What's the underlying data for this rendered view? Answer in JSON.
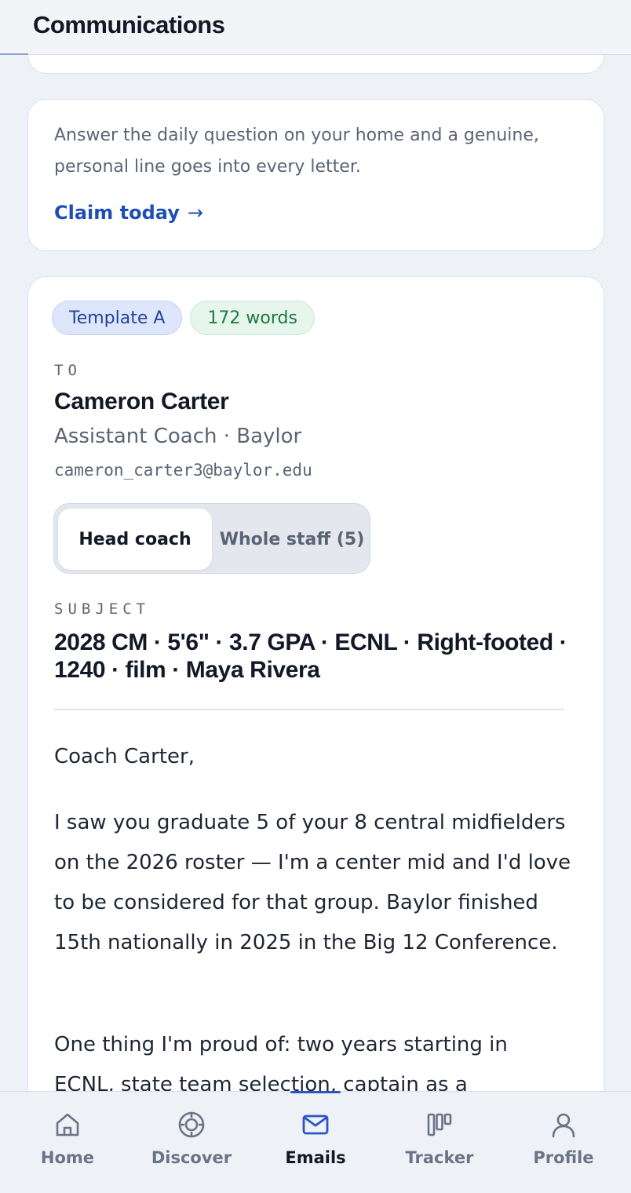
{
  "header": {
    "title": "Communications"
  },
  "daily": {
    "text": "Answer the daily question on your home and a genuine, personal line goes into every letter.",
    "cta_label": "Claim today",
    "cta_arrow": "→"
  },
  "email": {
    "template_badge": "Template A",
    "words_badge": "172 words",
    "to_label": "TO",
    "recipient_name": "Cameron Carter",
    "recipient_role": "Assistant Coach · Baylor",
    "recipient_email": "cameron_carter3@baylor.edu",
    "recipient_toggle": {
      "options": [
        "Head coach",
        "Whole staff (5)"
      ],
      "selected": "Head coach"
    },
    "subject_label": "SUBJECT",
    "subject": "2028 CM · 5'6\" · 3.7 GPA · ECNL · Right-footed · 1240 · film · Maya Rivera",
    "greeting": "Coach Carter,",
    "paragraph_1": "I saw you graduate 5 of your 8 central midfielders on the 2026 roster — I'm a center mid and I'd love to be considered for that group. Baylor finished 15th nationally in 2025 in the Big 12 Conference.",
    "paragraph_2": "One thing I'm proud of: two years starting in ECNL, state team selection, captain as a"
  },
  "tabbar": {
    "active": "Emails",
    "tabs": [
      {
        "label": "Home",
        "icon": "home-icon"
      },
      {
        "label": "Discover",
        "icon": "compass-icon"
      },
      {
        "label": "Emails",
        "icon": "mail-icon"
      },
      {
        "label": "Tracker",
        "icon": "kanban-icon"
      },
      {
        "label": "Profile",
        "icon": "user-icon"
      }
    ]
  },
  "colors": {
    "accent": "#1f4fb5",
    "active_tab": "#2a55c4",
    "background": "#eef1f6",
    "template_badge_bg": "#dde6fb",
    "words_badge_bg": "#e6f6ec"
  }
}
